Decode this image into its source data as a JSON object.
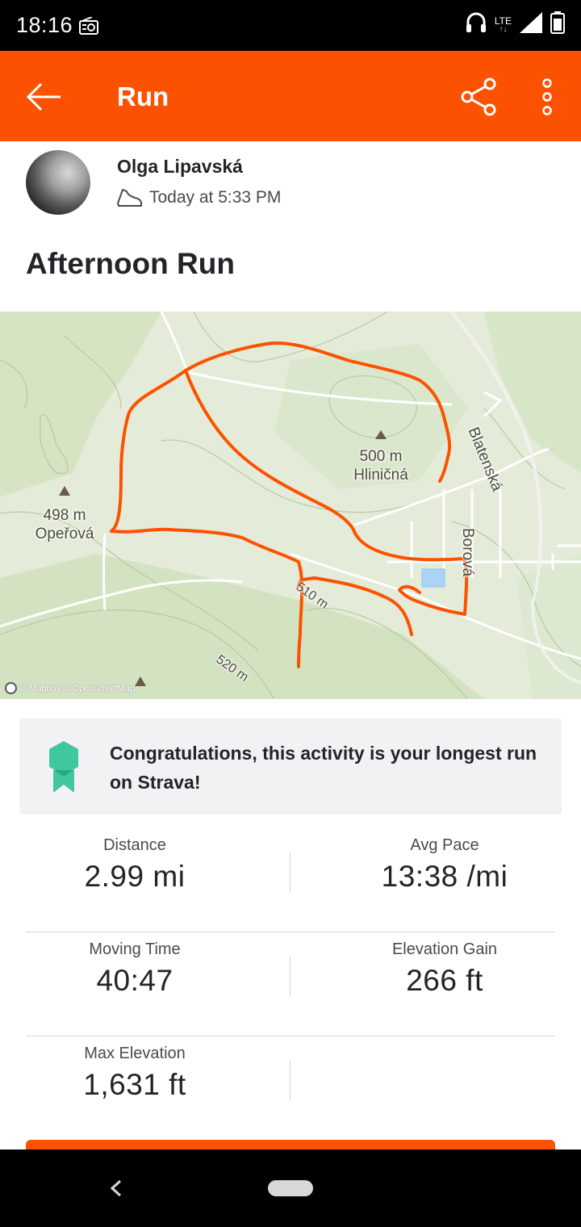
{
  "status_bar": {
    "time": "18:16",
    "network": "LTE"
  },
  "app_bar": {
    "title": "Run"
  },
  "activity": {
    "athlete_name": "Olga Lipavská",
    "timestamp": "Today at 5:33 PM",
    "title": "Afternoon Run"
  },
  "map": {
    "labels": {
      "peak1_elev": "500 m",
      "peak1_name": "Hliničná",
      "peak2_elev": "498 m",
      "peak2_name": "Opeřová",
      "street1": "Blatenská",
      "street2": "Borová",
      "contour1": "520 m",
      "contour2": "510 m"
    },
    "attribution": "© Mapbox © OpenStreetMap",
    "route_color": "#fc5200"
  },
  "achievement": {
    "text": "Congratulations, this activity is your longest run on Strava!"
  },
  "stats": [
    [
      {
        "label": "Distance",
        "value": "2.99 mi"
      },
      {
        "label": "Avg Pace",
        "value": "13:38 /mi"
      }
    ],
    [
      {
        "label": "Moving Time",
        "value": "40:47"
      },
      {
        "label": "Elevation Gain",
        "value": "266 ft"
      }
    ],
    [
      {
        "label": "Max Elevation",
        "value": "1,631 ft"
      }
    ]
  ],
  "colors": {
    "brand": "#fc5200",
    "badge": "#3fc7a0"
  }
}
